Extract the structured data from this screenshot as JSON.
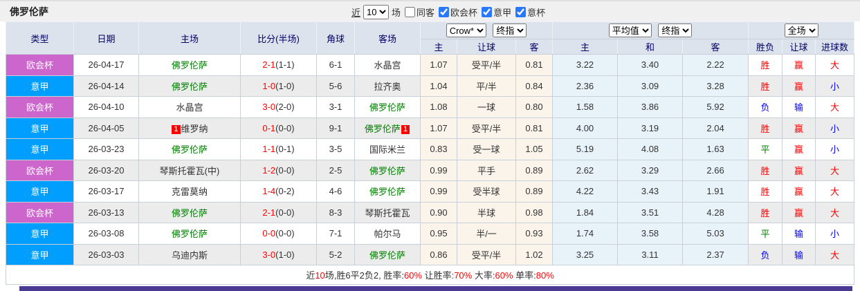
{
  "colors": {
    "cup_badge": "#cc66cc",
    "league_badge": "#009fff",
    "win": "#ff0000",
    "draw": "#008000",
    "loss": "#0000ff",
    "team_green": "#008000",
    "score_red": "#ff0000",
    "odds_bg": "#faf4eb",
    "avg_bg": "#e8f3f9",
    "header_bg": "#dce3ec",
    "header_text": "#000066",
    "stripe": "#ececec",
    "accent_bar": "#4a3a93"
  },
  "topbar": {
    "title": "佛罗伦萨",
    "near_label": "近",
    "recent_count": "10",
    "games_label": "场",
    "checkboxes": [
      {
        "label": "同客",
        "checked": false
      },
      {
        "label": "欧会杯",
        "checked": true
      },
      {
        "label": "意甲",
        "checked": true
      },
      {
        "label": "意杯",
        "checked": true
      }
    ]
  },
  "table": {
    "selects": {
      "bookmaker": "Crow*",
      "odds_stage": "终指",
      "average": "平均值",
      "avg_stage": "终指",
      "scope": "全场"
    },
    "headers": {
      "type": "类型",
      "date": "日期",
      "home": "主场",
      "score": "比分(半场)",
      "corner": "角球",
      "away": "客场",
      "odds_home": "主",
      "odds_handicap": "让球",
      "odds_away": "客",
      "avg_home": "主",
      "avg_draw": "和",
      "avg_away": "客",
      "wdl": "胜负",
      "handicap_result": "让球",
      "goals": "进球数"
    },
    "rows": [
      {
        "type": "欧会杯",
        "type_color": "#cc66cc",
        "date": "26-04-17",
        "home": "佛罗伦萨",
        "home_green": true,
        "home_badge": "",
        "score_ft": "2-1",
        "score_ht": "1-1",
        "corner": "6-1",
        "away": "水晶宫",
        "away_green": false,
        "away_badge": "",
        "odds_home": "1.07",
        "handicap": "受平/半",
        "odds_away": "0.81",
        "avg_home": "3.22",
        "avg_draw": "3.40",
        "avg_away": "2.22",
        "wdl": "胜",
        "wdl_c": "win",
        "hres": "赢",
        "hres_c": "win",
        "goals": "大",
        "goals_c": "win"
      },
      {
        "type": "意甲",
        "type_color": "#009fff",
        "date": "26-04-14",
        "home": "佛罗伦萨",
        "home_green": true,
        "home_badge": "",
        "score_ft": "1-0",
        "score_ht": "1-0",
        "corner": "5-6",
        "away": "拉齐奥",
        "away_green": false,
        "away_badge": "",
        "odds_home": "1.04",
        "handicap": "平/半",
        "odds_away": "0.84",
        "avg_home": "2.36",
        "avg_draw": "3.09",
        "avg_away": "3.28",
        "wdl": "胜",
        "wdl_c": "win",
        "hres": "赢",
        "hres_c": "win",
        "goals": "小",
        "goals_c": "loss"
      },
      {
        "type": "欧会杯",
        "type_color": "#cc66cc",
        "date": "26-04-10",
        "home": "水晶宫",
        "home_green": false,
        "home_badge": "",
        "score_ft": "3-0",
        "score_ht": "2-0",
        "corner": "3-1",
        "away": "佛罗伦萨",
        "away_green": true,
        "away_badge": "",
        "odds_home": "1.08",
        "handicap": "一球",
        "odds_away": "0.80",
        "avg_home": "1.58",
        "avg_draw": "3.86",
        "avg_away": "5.92",
        "wdl": "负",
        "wdl_c": "loss",
        "hres": "输",
        "hres_c": "loss",
        "goals": "大",
        "goals_c": "win"
      },
      {
        "type": "意甲",
        "type_color": "#009fff",
        "date": "26-04-05",
        "home": "维罗纳",
        "home_green": false,
        "home_badge": "1",
        "score_ft": "0-1",
        "score_ht": "0-0",
        "corner": "9-1",
        "away": "佛罗伦萨",
        "away_green": true,
        "away_badge": "1",
        "odds_home": "1.07",
        "handicap": "受平/半",
        "odds_away": "0.81",
        "avg_home": "4.00",
        "avg_draw": "3.19",
        "avg_away": "2.04",
        "wdl": "胜",
        "wdl_c": "win",
        "hres": "赢",
        "hres_c": "win",
        "goals": "小",
        "goals_c": "loss"
      },
      {
        "type": "意甲",
        "type_color": "#009fff",
        "date": "26-03-23",
        "home": "佛罗伦萨",
        "home_green": true,
        "home_badge": "",
        "score_ft": "1-1",
        "score_ht": "0-1",
        "corner": "3-5",
        "away": "国际米兰",
        "away_green": false,
        "away_badge": "",
        "odds_home": "0.83",
        "handicap": "受一球",
        "odds_away": "1.05",
        "avg_home": "5.19",
        "avg_draw": "4.08",
        "avg_away": "1.63",
        "wdl": "平",
        "wdl_c": "draw",
        "hres": "赢",
        "hres_c": "win",
        "goals": "小",
        "goals_c": "loss"
      },
      {
        "type": "欧会杯",
        "type_color": "#cc66cc",
        "date": "26-03-20",
        "home": "琴斯托霍瓦(中)",
        "home_green": false,
        "home_badge": "",
        "score_ft": "1-2",
        "score_ht": "0-0",
        "corner": "2-5",
        "away": "佛罗伦萨",
        "away_green": true,
        "away_badge": "",
        "odds_home": "0.99",
        "handicap": "平手",
        "odds_away": "0.89",
        "avg_home": "2.62",
        "avg_draw": "3.29",
        "avg_away": "2.66",
        "wdl": "胜",
        "wdl_c": "win",
        "hres": "赢",
        "hres_c": "win",
        "goals": "大",
        "goals_c": "win"
      },
      {
        "type": "意甲",
        "type_color": "#009fff",
        "date": "26-03-17",
        "home": "克雷莫纳",
        "home_green": false,
        "home_badge": "",
        "score_ft": "1-4",
        "score_ht": "0-2",
        "corner": "4-6",
        "away": "佛罗伦萨",
        "away_green": true,
        "away_badge": "",
        "odds_home": "0.99",
        "handicap": "受半球",
        "odds_away": "0.89",
        "avg_home": "4.22",
        "avg_draw": "3.43",
        "avg_away": "1.91",
        "wdl": "胜",
        "wdl_c": "win",
        "hres": "赢",
        "hres_c": "win",
        "goals": "大",
        "goals_c": "win"
      },
      {
        "type": "欧会杯",
        "type_color": "#cc66cc",
        "date": "26-03-13",
        "home": "佛罗伦萨",
        "home_green": true,
        "home_badge": "",
        "score_ft": "2-1",
        "score_ht": "0-0",
        "corner": "8-3",
        "away": "琴斯托霍瓦",
        "away_green": false,
        "away_badge": "",
        "odds_home": "0.90",
        "handicap": "半球",
        "odds_away": "0.98",
        "avg_home": "1.84",
        "avg_draw": "3.51",
        "avg_away": "4.28",
        "wdl": "胜",
        "wdl_c": "win",
        "hres": "赢",
        "hres_c": "win",
        "goals": "大",
        "goals_c": "win"
      },
      {
        "type": "意甲",
        "type_color": "#009fff",
        "date": "26-03-08",
        "home": "佛罗伦萨",
        "home_green": true,
        "home_badge": "",
        "score_ft": "0-0",
        "score_ht": "0-0",
        "corner": "7-1",
        "away": "帕尔马",
        "away_green": false,
        "away_badge": "",
        "odds_home": "0.95",
        "handicap": "半/一",
        "odds_away": "0.93",
        "avg_home": "1.74",
        "avg_draw": "3.58",
        "avg_away": "5.03",
        "wdl": "平",
        "wdl_c": "draw",
        "hres": "输",
        "hres_c": "loss",
        "goals": "小",
        "goals_c": "loss"
      },
      {
        "type": "意甲",
        "type_color": "#009fff",
        "date": "26-03-03",
        "home": "乌迪内斯",
        "home_green": false,
        "home_badge": "",
        "score_ft": "3-0",
        "score_ht": "1-0",
        "corner": "5-2",
        "away": "佛罗伦萨",
        "away_green": true,
        "away_badge": "",
        "odds_home": "0.86",
        "handicap": "受平/半",
        "odds_away": "1.02",
        "avg_home": "3.25",
        "avg_draw": "3.11",
        "avg_away": "2.37",
        "wdl": "负",
        "wdl_c": "loss",
        "hres": "输",
        "hres_c": "loss",
        "goals": "大",
        "goals_c": "win"
      }
    ]
  },
  "footer": {
    "segments": [
      {
        "text": "近",
        "c": "d"
      },
      {
        "text": "10",
        "c": "r"
      },
      {
        "text": "场,胜6平2负2, 胜率:",
        "c": "d"
      },
      {
        "text": "60%",
        "c": "r"
      },
      {
        "text": " 让胜率:",
        "c": "d"
      },
      {
        "text": "70%",
        "c": "r"
      },
      {
        "text": " 大率:",
        "c": "d"
      },
      {
        "text": "60%",
        "c": "r"
      },
      {
        "text": " 单率:",
        "c": "d"
      },
      {
        "text": "80%",
        "c": "r"
      }
    ]
  }
}
